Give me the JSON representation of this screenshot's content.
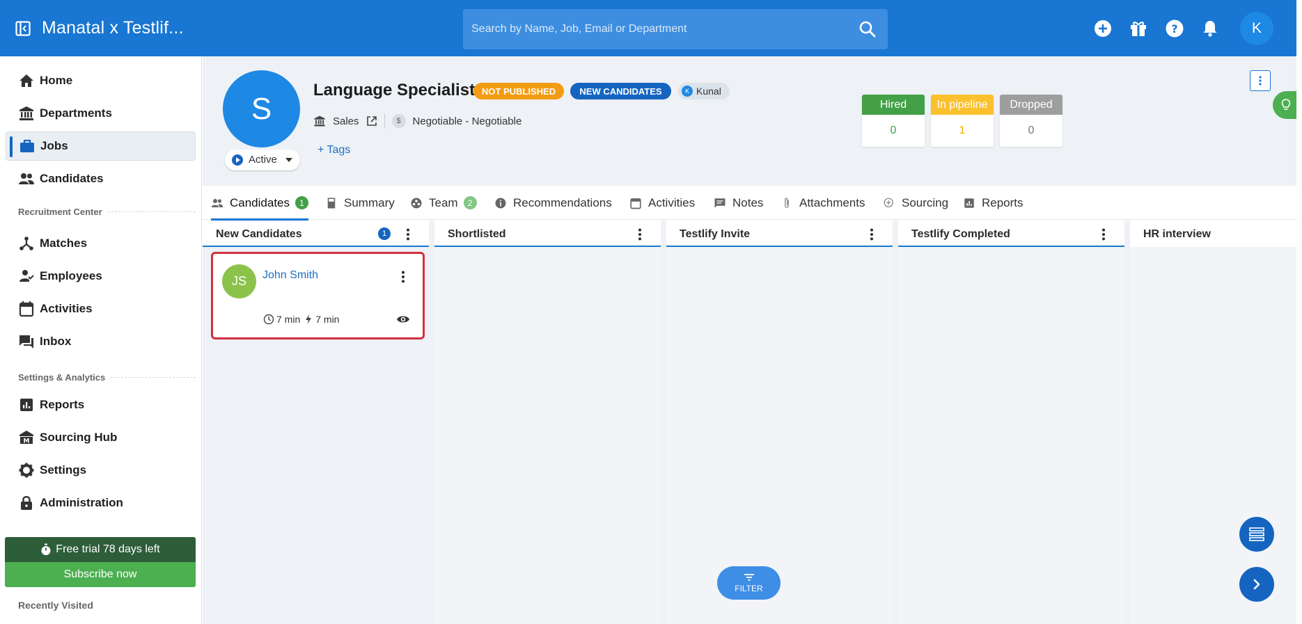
{
  "topbar": {
    "app_title": "Manatal x Testlif...",
    "search_placeholder": "Search by Name, Job, Email or Department",
    "user_initial": "K",
    "icons": [
      "plus-circle-icon",
      "gift-icon",
      "help-icon",
      "bell-icon"
    ]
  },
  "sidebar": {
    "items": [
      {
        "label": "Home",
        "icon": "home-icon"
      },
      {
        "label": "Departments",
        "icon": "bank-icon"
      },
      {
        "label": "Jobs",
        "icon": "briefcase-icon",
        "active": true
      },
      {
        "label": "Candidates",
        "icon": "people-icon"
      }
    ],
    "section_recruitment": "Recruitment Center",
    "recruitment_items": [
      {
        "label": "Matches",
        "icon": "hub-icon"
      },
      {
        "label": "Employees",
        "icon": "person-check-icon"
      },
      {
        "label": "Activities",
        "icon": "calendar-icon"
      },
      {
        "label": "Inbox",
        "icon": "chat-icon"
      }
    ],
    "section_settings": "Settings & Analytics",
    "settings_items": [
      {
        "label": "Reports",
        "icon": "bar-chart-icon"
      },
      {
        "label": "Sourcing Hub",
        "icon": "sourcing-icon"
      },
      {
        "label": "Settings",
        "icon": "gear-icon"
      },
      {
        "label": "Administration",
        "icon": "lock-icon"
      }
    ],
    "trial_text": "Free trial 78 days left",
    "subscribe_label": "Subscribe now",
    "recently_visited": "Recently Visited"
  },
  "job": {
    "avatar_letter": "S",
    "title": "Language Specialist",
    "badge_status": "NOT PUBLISHED",
    "badge_new": "NEW CANDIDATES",
    "owner_initial": "K",
    "owner_name": "Kunal",
    "department": "Sales",
    "salary": "Negotiable - Negotiable",
    "tags_label": "+ Tags",
    "status": "Active",
    "stats": [
      {
        "label": "Hired",
        "value": "0",
        "color": "#43a047"
      },
      {
        "label": "In pipeline",
        "value": "1",
        "color": "#fbc02d"
      },
      {
        "label": "Dropped",
        "value": "0",
        "color": "#9e9e9e"
      }
    ]
  },
  "tabs": [
    {
      "label": "Candidates",
      "count": "1",
      "active": true
    },
    {
      "label": "Summary"
    },
    {
      "label": "Team",
      "count": "2"
    },
    {
      "label": "Recommendations"
    },
    {
      "label": "Activities"
    },
    {
      "label": "Notes"
    },
    {
      "label": "Attachments"
    },
    {
      "label": "Sourcing"
    },
    {
      "label": "Reports"
    }
  ],
  "columns": [
    {
      "title": "New Candidates",
      "count": "1"
    },
    {
      "title": "Shortlisted"
    },
    {
      "title": "Testlify Invite"
    },
    {
      "title": "Testlify Completed"
    },
    {
      "title": "HR interview"
    }
  ],
  "candidate": {
    "initials": "JS",
    "name": "John Smith",
    "time_in_stage": "7 min",
    "time_active": "7 min"
  },
  "filter_label": "FILTER"
}
